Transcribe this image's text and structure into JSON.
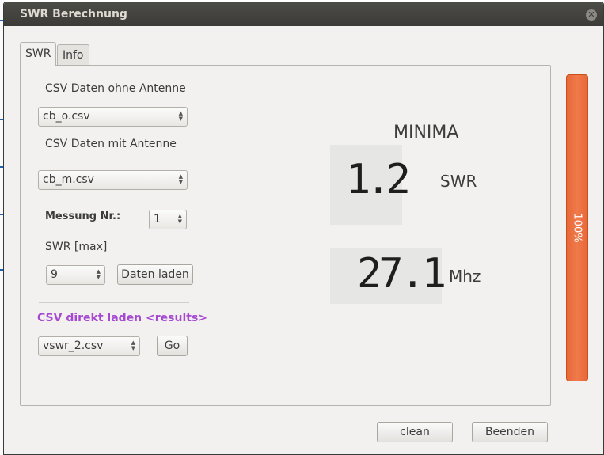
{
  "window": {
    "title": "SWR Berechnung",
    "close_glyph": "✕"
  },
  "tabs": [
    {
      "label": "SWR",
      "active": true
    },
    {
      "label": "Info",
      "active": false
    }
  ],
  "form": {
    "csv_without_antenna_label": "CSV Daten ohne Antenne",
    "csv_without_antenna_value": "cb_o.csv",
    "csv_with_antenna_label": "CSV Daten mit Antenne",
    "csv_with_antenna_value": "cb_m.csv",
    "measurement_label": "Messung Nr.:",
    "measurement_value": "1",
    "swr_max_label": "SWR [max]",
    "swr_max_value": "9",
    "load_button": "Daten laden",
    "direct_load_label": "CSV direkt laden <results>",
    "results_file_value": "vswr_2.csv",
    "go_button": "Go"
  },
  "display": {
    "heading": "MINIMA",
    "swr_value": "1.2",
    "swr_unit": "SWR",
    "freq_value": "27.1",
    "freq_unit": "Mhz"
  },
  "progress": {
    "value": 1.0,
    "text": "100%"
  },
  "footer": {
    "clean_button": "clean",
    "exit_button": "Beenden"
  },
  "icons": {
    "combo_arrows": "updown-arrows-icon",
    "close": "close-icon"
  }
}
